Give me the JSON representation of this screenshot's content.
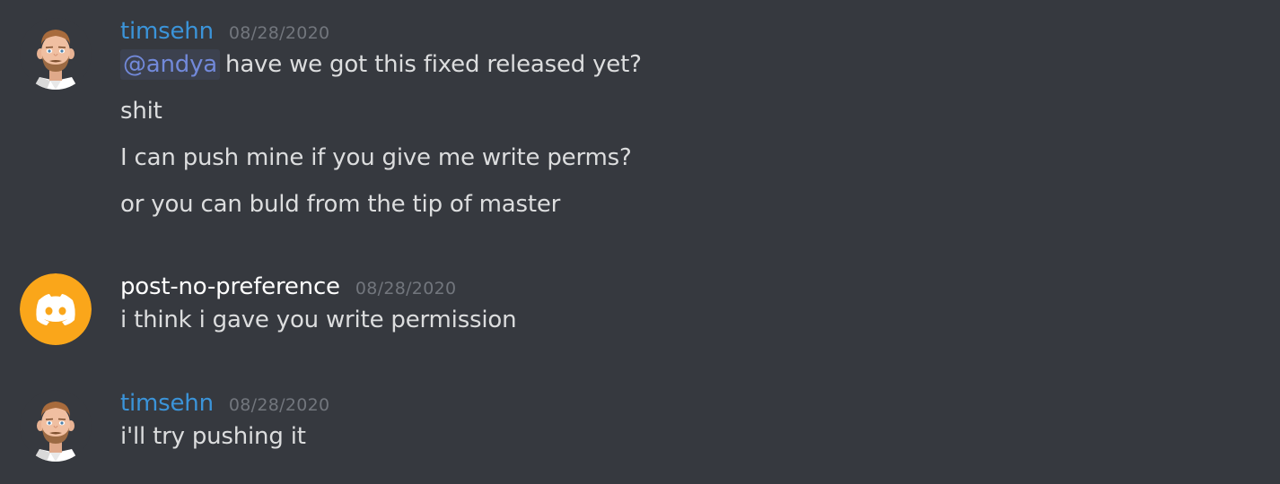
{
  "theme": {
    "background": "#36393f",
    "text": "#dcddde",
    "timestamp": "#72767d",
    "mention_text": "#7289da",
    "mention_bg": "rgba(114,137,218,0.1)"
  },
  "messages": [
    {
      "author": "timsehn",
      "author_color": "#3b94d9",
      "avatar": "bearded-man-avatar",
      "timestamp": "08/28/2020",
      "mention": "@andya",
      "lines": [
        "have we got this fixed released yet?",
        "shit",
        "I can push mine if you give me write perms?",
        "or you can buld from the tip of master"
      ]
    },
    {
      "author": "post-no-preference",
      "author_color": "#ffffff",
      "avatar": "discord-logo-avatar",
      "avatar_bg": "#faa61a",
      "timestamp": "08/28/2020",
      "lines": [
        "i think i gave you write permission"
      ]
    },
    {
      "author": "timsehn",
      "author_color": "#3b94d9",
      "avatar": "bearded-man-avatar",
      "timestamp": "08/28/2020",
      "lines": [
        "i'll try pushing it"
      ]
    }
  ]
}
